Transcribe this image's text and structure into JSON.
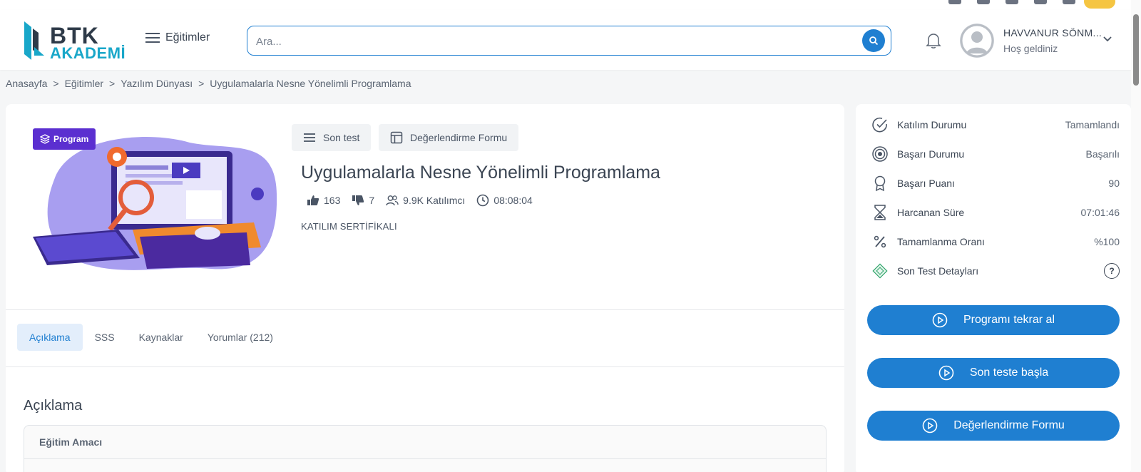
{
  "header": {
    "logo_top": "BTK",
    "logo_bottom": "AKADEMİ",
    "menu_label": "Eğitimler",
    "search_placeholder": "Ara...",
    "user_name": "HAVVANUR SÖNM...",
    "user_greeting": "Hoş geldiniz"
  },
  "breadcrumb": [
    "Anasayfa",
    "Eğitimler",
    "Yazılım Dünyası",
    "Uygulamalarla Nesne Yönelimli Programlama"
  ],
  "breadcrumb_sep": ">",
  "course": {
    "badge": "Program",
    "actions": [
      "Son test",
      "Değerlendirme Formu"
    ],
    "title": "Uygulamalarla Nesne Yönelimli Programlama",
    "likes": "163",
    "dislikes": "7",
    "participants": "9.9K Katılımcı",
    "duration": "08:08:04",
    "certificate": "KATILIM SERTİFİKALI"
  },
  "tabs": [
    "Açıklama",
    "SSS",
    "Kaynaklar",
    "Yorumlar (212)"
  ],
  "active_tab": "Açıklama",
  "description": {
    "title": "Açıklama",
    "box_header": "Eğitim Amacı"
  },
  "status": {
    "rows": [
      {
        "label": "Katılım Durumu",
        "value": "Tamamlandı",
        "icon": "check-circle-icon"
      },
      {
        "label": "Başarı Durumu",
        "value": "Başarılı",
        "icon": "target-icon"
      },
      {
        "label": "Başarı Puanı",
        "value": "90",
        "icon": "award-icon"
      },
      {
        "label": "Harcanan Süre",
        "value": "07:01:46",
        "icon": "hourglass-icon"
      },
      {
        "label": "Tamamlanma Oranı",
        "value": "%100",
        "icon": "percent-icon"
      },
      {
        "label": "Son Test Detayları",
        "icon": "test-details-icon"
      }
    ],
    "buttons": [
      "Programı tekrar al",
      "Son teste başla",
      "Değerlendirme Formu"
    ]
  },
  "colors": {
    "accent": "#1f7fd1",
    "badge": "#5b2fd0",
    "logo_teal": "#19a7c9"
  }
}
